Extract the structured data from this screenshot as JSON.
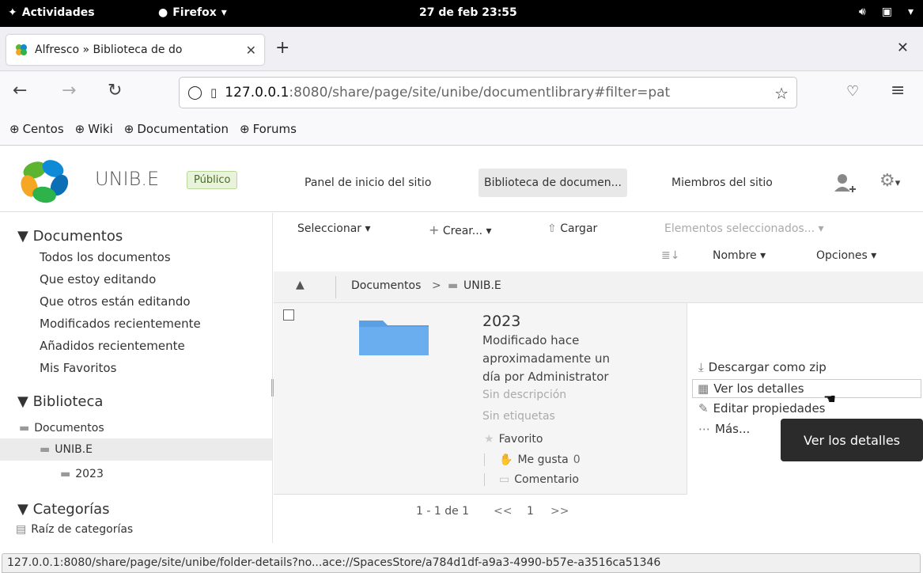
{
  "topbar": {
    "activities": "Actividades",
    "app": "Firefox",
    "clock": "27 de feb  23:55"
  },
  "browser": {
    "tab_title": "Alfresco » Biblioteca de do",
    "url_host": "127.0.0.1",
    "url_rest": ":8080/share/page/site/unibe/documentlibrary#filter=pat",
    "bookmarks": [
      "Centos",
      "Wiki",
      "Documentation",
      "Forums"
    ]
  },
  "site": {
    "title": "UNIB.E",
    "visibility": "Público",
    "nav": [
      "Panel de inicio del sitio",
      "Biblioteca de documen...",
      "Miembros del sitio"
    ]
  },
  "sidebar": {
    "documents_header": "▼ Documentos",
    "document_filters": [
      "Todos los documentos",
      "Que estoy editando",
      "Que otros están editando",
      "Modificados recientemente",
      "Añadidos recientemente",
      "Mis Favoritos"
    ],
    "library_header": "▼ Biblioteca",
    "tree": [
      "Documentos",
      "UNIB.E",
      "2023"
    ],
    "categories_header": "▼ Categorías",
    "categories_root": "Raíz de categorías"
  },
  "toolbar": {
    "select": "Seleccionar ▾",
    "create": "Crear... ▾",
    "upload": "Cargar",
    "selected_items": "Elementos seleccionados... ▾",
    "sort": "Nombre ▾",
    "options": "Opciones ▾"
  },
  "breadcrumb": {
    "root": "Documentos",
    "separator": ">",
    "current": "UNIB.E"
  },
  "document": {
    "name": "2023",
    "modified_line1": "Modificado hace",
    "modified_line2": "aproximadamente un",
    "modified_line3": "día por Administrator",
    "no_description": "Sin descripción",
    "no_tags": "Sin etiquetas",
    "favorite": "Favorito",
    "like": "Me gusta",
    "like_count": "0",
    "comment": "Comentario"
  },
  "actions": {
    "download_zip": "Descargar como zip",
    "view_details": "Ver los detalles",
    "edit_properties": "Editar propiedades",
    "more": "Más..."
  },
  "tooltip": "Ver los detalles",
  "paginator": {
    "range": "1 - 1 de 1",
    "first": "<<",
    "page": "1",
    "next": ">>"
  },
  "status_url": "127.0.0.1:8080/share/page/site/unibe/folder-details?no...ace://SpacesStore/a784d1df-a9a3-4990-b57e-a3516ca51346",
  "colors": {
    "topbar": "#000000",
    "folder": "#5b9fe4",
    "badge_bg": "#e9f3dc",
    "tooltip_bg": "#2b2b2b"
  }
}
